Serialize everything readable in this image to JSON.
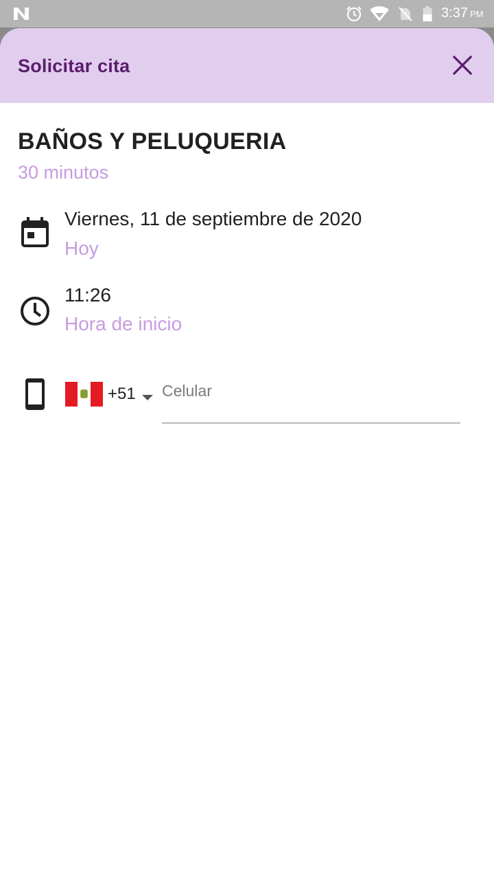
{
  "status_bar": {
    "time": "3:37",
    "ampm": "PM",
    "icons": [
      "n-logo-icon",
      "alarm-icon",
      "wifi-icon",
      "no-sim-icon",
      "battery-icon"
    ]
  },
  "sheet": {
    "title": "Solicitar cita",
    "close_icon": "close-icon"
  },
  "service": {
    "name": "BAÑOS Y PELUQUERIA",
    "duration": "30 minutos"
  },
  "date": {
    "icon": "calendar-icon",
    "value": "Viernes, 11 de septiembre de 2020",
    "label": "Hoy"
  },
  "time": {
    "icon": "clock-icon",
    "value": "11:26",
    "label": "Hora de inicio"
  },
  "phone": {
    "icon": "smartphone-icon",
    "country_flag": "peru-flag-icon",
    "dial_code": "+51",
    "placeholder": "Celular",
    "value": ""
  },
  "colors": {
    "header_bg": "#e1cdee",
    "title": "#5a1d6c",
    "accent_text": "#c79be0",
    "status_bar": "#b5b5b5"
  }
}
